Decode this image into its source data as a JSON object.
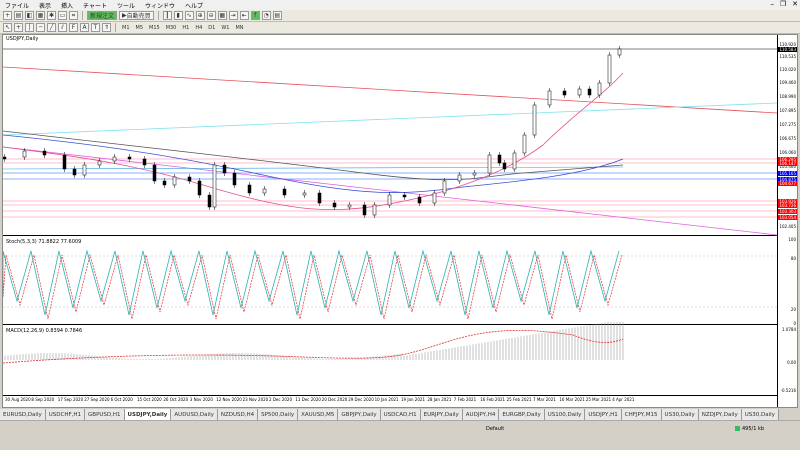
{
  "menu": [
    "ファイル",
    "表示",
    "挿入",
    "チャート",
    "ツール",
    "ウィンドウ",
    "ヘルプ"
  ],
  "toolbar": {
    "new_order": "新規注文",
    "auto_trade": "自動売買"
  },
  "timeframes": [
    "M1",
    "M5",
    "M15",
    "M30",
    "H1",
    "H4",
    "D1",
    "W1",
    "MN"
  ],
  "chart": {
    "symbol": "USDJPY,Daily",
    "stoch": "Stoch(5,3,3) 71.8822 77.6009",
    "macd": "MACD(12,26,9) 0.8394 0.7846",
    "price_axis": [
      "110.920",
      "110.535",
      "110.020",
      "109.460",
      "108.990",
      "107.895",
      "107.275",
      "106.675",
      "106.060",
      "105.460",
      "104.875",
      "103.880",
      "102.405"
    ],
    "price_labels": [
      {
        "text": "110.583",
        "color": "#000000"
      },
      {
        "text": "106.295",
        "color": "#ff0000"
      },
      {
        "text": "106.147",
        "color": "#ff0000"
      },
      {
        "text": "105.165",
        "color": "#0000ff"
      },
      {
        "text": "104.875",
        "color": "#0000ff"
      },
      {
        "text": "104.677",
        "color": "#ff0000"
      },
      {
        "text": "103.926",
        "color": "#ff0000"
      },
      {
        "text": "103.726",
        "color": "#ff0000"
      },
      {
        "text": "103.303",
        "color": "#ff0000"
      },
      {
        "text": "103.054",
        "color": "#ff0000"
      }
    ],
    "stoch_axis": [
      "100",
      "80",
      "20",
      "0"
    ],
    "macd_axis": [
      "1.0784",
      "0.00",
      "-0.5216"
    ],
    "dates": [
      "30 Aug 2020",
      "8 Sep 2020",
      "17 Sep 2020",
      "27 Sep 2020",
      "6 Oct 2020",
      "15 Oct 2020",
      "26 Oct 2020",
      "3 Nov 2020",
      "12 Nov 2020",
      "23 Nov 2020",
      "2 Dec 2020",
      "11 Dec 2020",
      "20 Dec 2020",
      "29 Dec 2020",
      "10 Jan 2021",
      "19 Jan 2021",
      "28 Jan 2021",
      "7 Feb 2021",
      "16 Feb 2021",
      "25 Feb 2021",
      "7 Mar 2021",
      "16 Mar 2021",
      "25 Mar 2021",
      "4 Apr 2021"
    ]
  },
  "tabs": [
    "EURUSD,Daily",
    "USDCHF,H1",
    "GBPUSD,H1",
    "USDJPY,Daily",
    "AUDUSD,Daily",
    "NZDUSD,H4",
    "SP500,Daily",
    "XAUUSD,M5",
    "GBPJPY,Daily",
    "USDCAD,H1",
    "EURJPY,Daily",
    "AUDJPY,H4",
    "EURGBP,Daily",
    "US100,Daily",
    "USDJPY,H1",
    "CHFJPY,M15",
    "US30,Daily",
    "NZDJPY,Daily",
    "US30,Daily"
  ],
  "active_tab": 3,
  "status": {
    "profile": "Default",
    "traffic": "495/1 kb"
  }
}
